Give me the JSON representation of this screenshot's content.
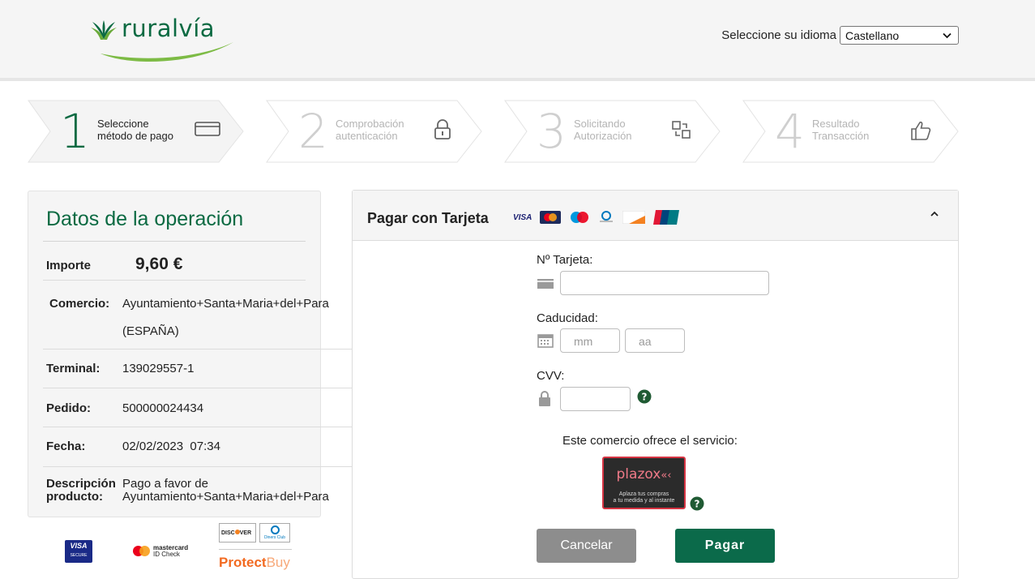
{
  "header": {
    "logo_text": "ruralvía",
    "language_label": "Seleccione su idioma",
    "language_value": "Castellano"
  },
  "steps": [
    {
      "number": "1",
      "line1": "Seleccione",
      "line2": "método de pago",
      "icon": "credit-card-icon",
      "state": "active"
    },
    {
      "number": "2",
      "line1": "Comprobación",
      "line2": "autenticación",
      "icon": "lock-icon",
      "state": "inactive"
    },
    {
      "number": "3",
      "line1": "Solicitando",
      "line2": "Autorización",
      "icon": "transfer-icon",
      "state": "inactive"
    },
    {
      "number": "4",
      "line1": "Resultado",
      "line2": "Transacción",
      "icon": "thumbs-up-icon",
      "state": "inactive"
    }
  ],
  "operation": {
    "title": "Datos de la operación",
    "amount_label": "Importe",
    "amount_value": "9,60 €",
    "merchant_label": "Comercio:",
    "merchant_value": "Ayuntamiento+Santa+Maria+del+Para",
    "merchant_country": "(ESPAÑA)",
    "terminal_label": "Terminal:",
    "terminal_value": "139029557-1",
    "order_label": "Pedido:",
    "order_value": "500000024434",
    "date_label": "Fecha:",
    "date_value": "02/02/2023  07:34",
    "desc_label_1": "Descripción",
    "desc_label_2": "producto:",
    "desc_value_1": "Pago a favor de",
    "desc_value_2": "Ayuntamiento+Santa+Maria+del+Para"
  },
  "security_logos": {
    "visa": "VISA",
    "visa_sub": "SECURE",
    "mastercard_1": "mastercard",
    "mastercard_2": "ID Check",
    "discover": "DISC",
    "discover_2": "VER",
    "diners": "Diners Club",
    "protectbuy_1": "Protect",
    "protectbuy_2": "Buy"
  },
  "card_form": {
    "title": "Pagar con Tarjeta",
    "card_number_label": "Nº Tarjeta:",
    "card_number_value": "",
    "expiry_label": "Caducidad:",
    "month_placeholder": "mm",
    "year_placeholder": "aa",
    "cvv_label": "CVV:",
    "cvv_value": "",
    "offer_text": "Este comercio ofrece el servicio:",
    "plazox_name": "plazox",
    "plazox_tag_1": "Aplaza tus compras",
    "plazox_tag_2": "a tu medida y al instante",
    "cancel_label": "Cancelar",
    "pay_label": "Pagar"
  },
  "colors": {
    "brand_green": "#0b6a42",
    "pay_button": "#0b6a4a",
    "cancel_button": "#8d8d8d",
    "plazox_border": "#d63443"
  }
}
